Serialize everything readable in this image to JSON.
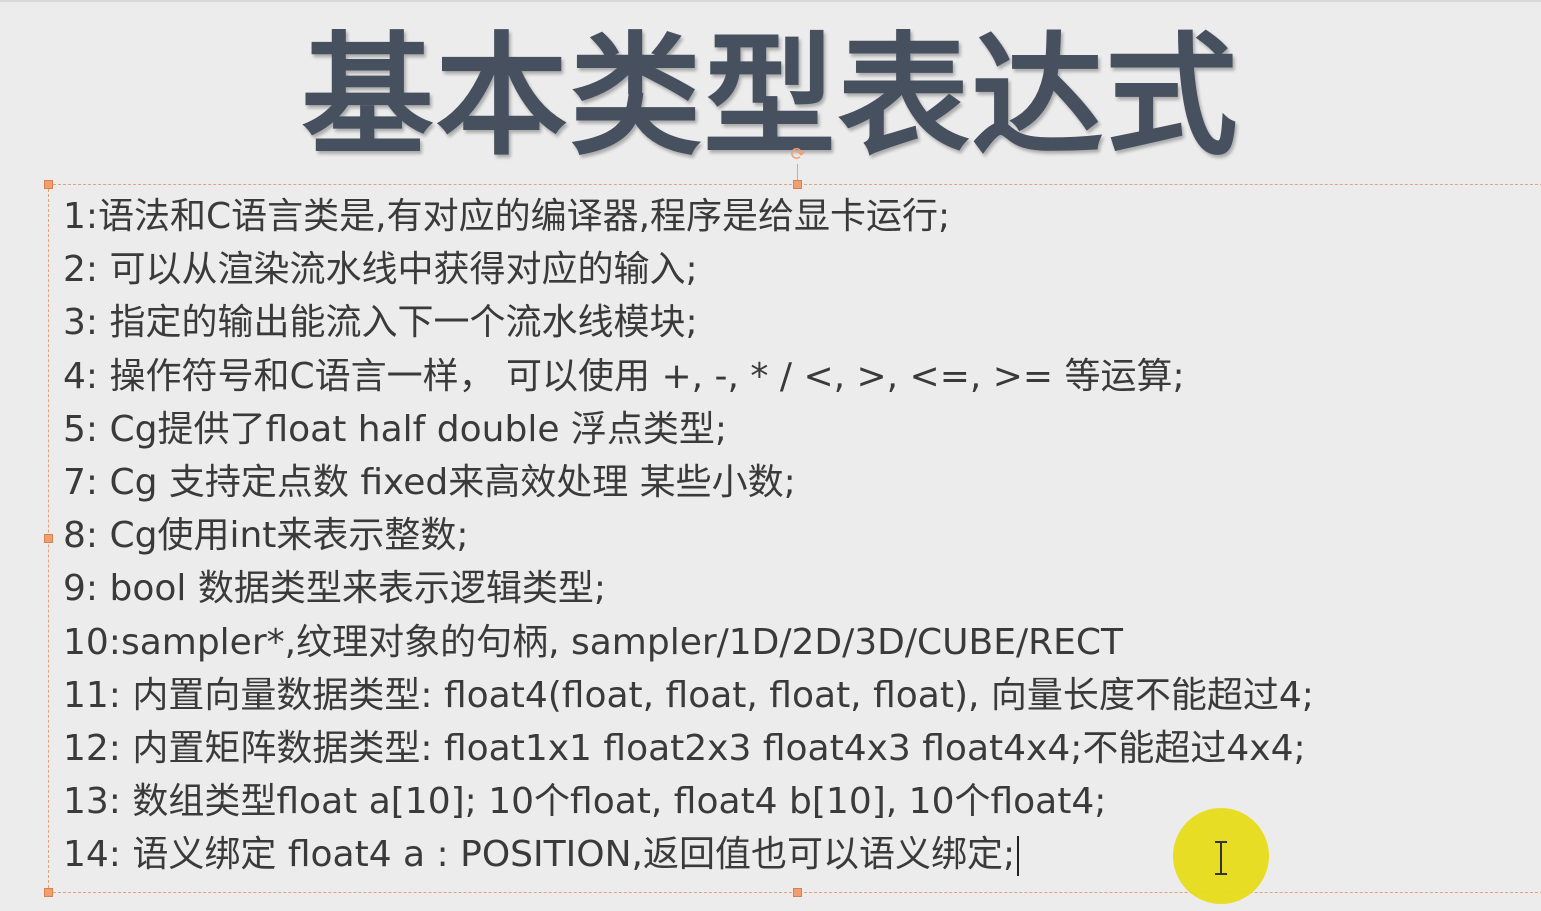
{
  "slide": {
    "title": "基本类型表达式",
    "items": [
      "1:语法和C语言类是,有对应的编译器,程序是给显卡运行;",
      "2: 可以从渲染流水线中获得对应的输入;",
      "3: 指定的输出能流入下一个流水线模块;",
      "4: 操作符号和C语言一样， 可以使用 +, -, * /  <, >, <=, >= 等运算;",
      "5: Cg提供了float half double 浮点类型;",
      "7: Cg 支持定点数 fixed来高效处理 某些小数;",
      "8: Cg使用int来表示整数;",
      "9: bool 数据类型来表示逻辑类型;",
      "10:sampler*,纹理对象的句柄, sampler/1D/2D/3D/CUBE/RECT",
      "11: 内置向量数据类型: float4(float, float, float, float), 向量长度不能超过4;",
      "12: 内置矩阵数据类型: float1x1 float2x3 float4x3 float4x4;不能超过4x4;",
      "13: 数组类型float a[10]; 10个float, float4 b[10], 10个float4;",
      "14: 语义绑定 float4 a : POSITION,返回值也可以语义绑定;"
    ]
  },
  "colors": {
    "background": "#ececec",
    "title": "#46505e",
    "text": "#3a3a3a",
    "selection": "#f0a070",
    "cursor_highlight": "#e8dc1a"
  },
  "icons": {
    "rotate": "rotate-handle-icon",
    "cursor": "text-ibeam-cursor-icon"
  }
}
